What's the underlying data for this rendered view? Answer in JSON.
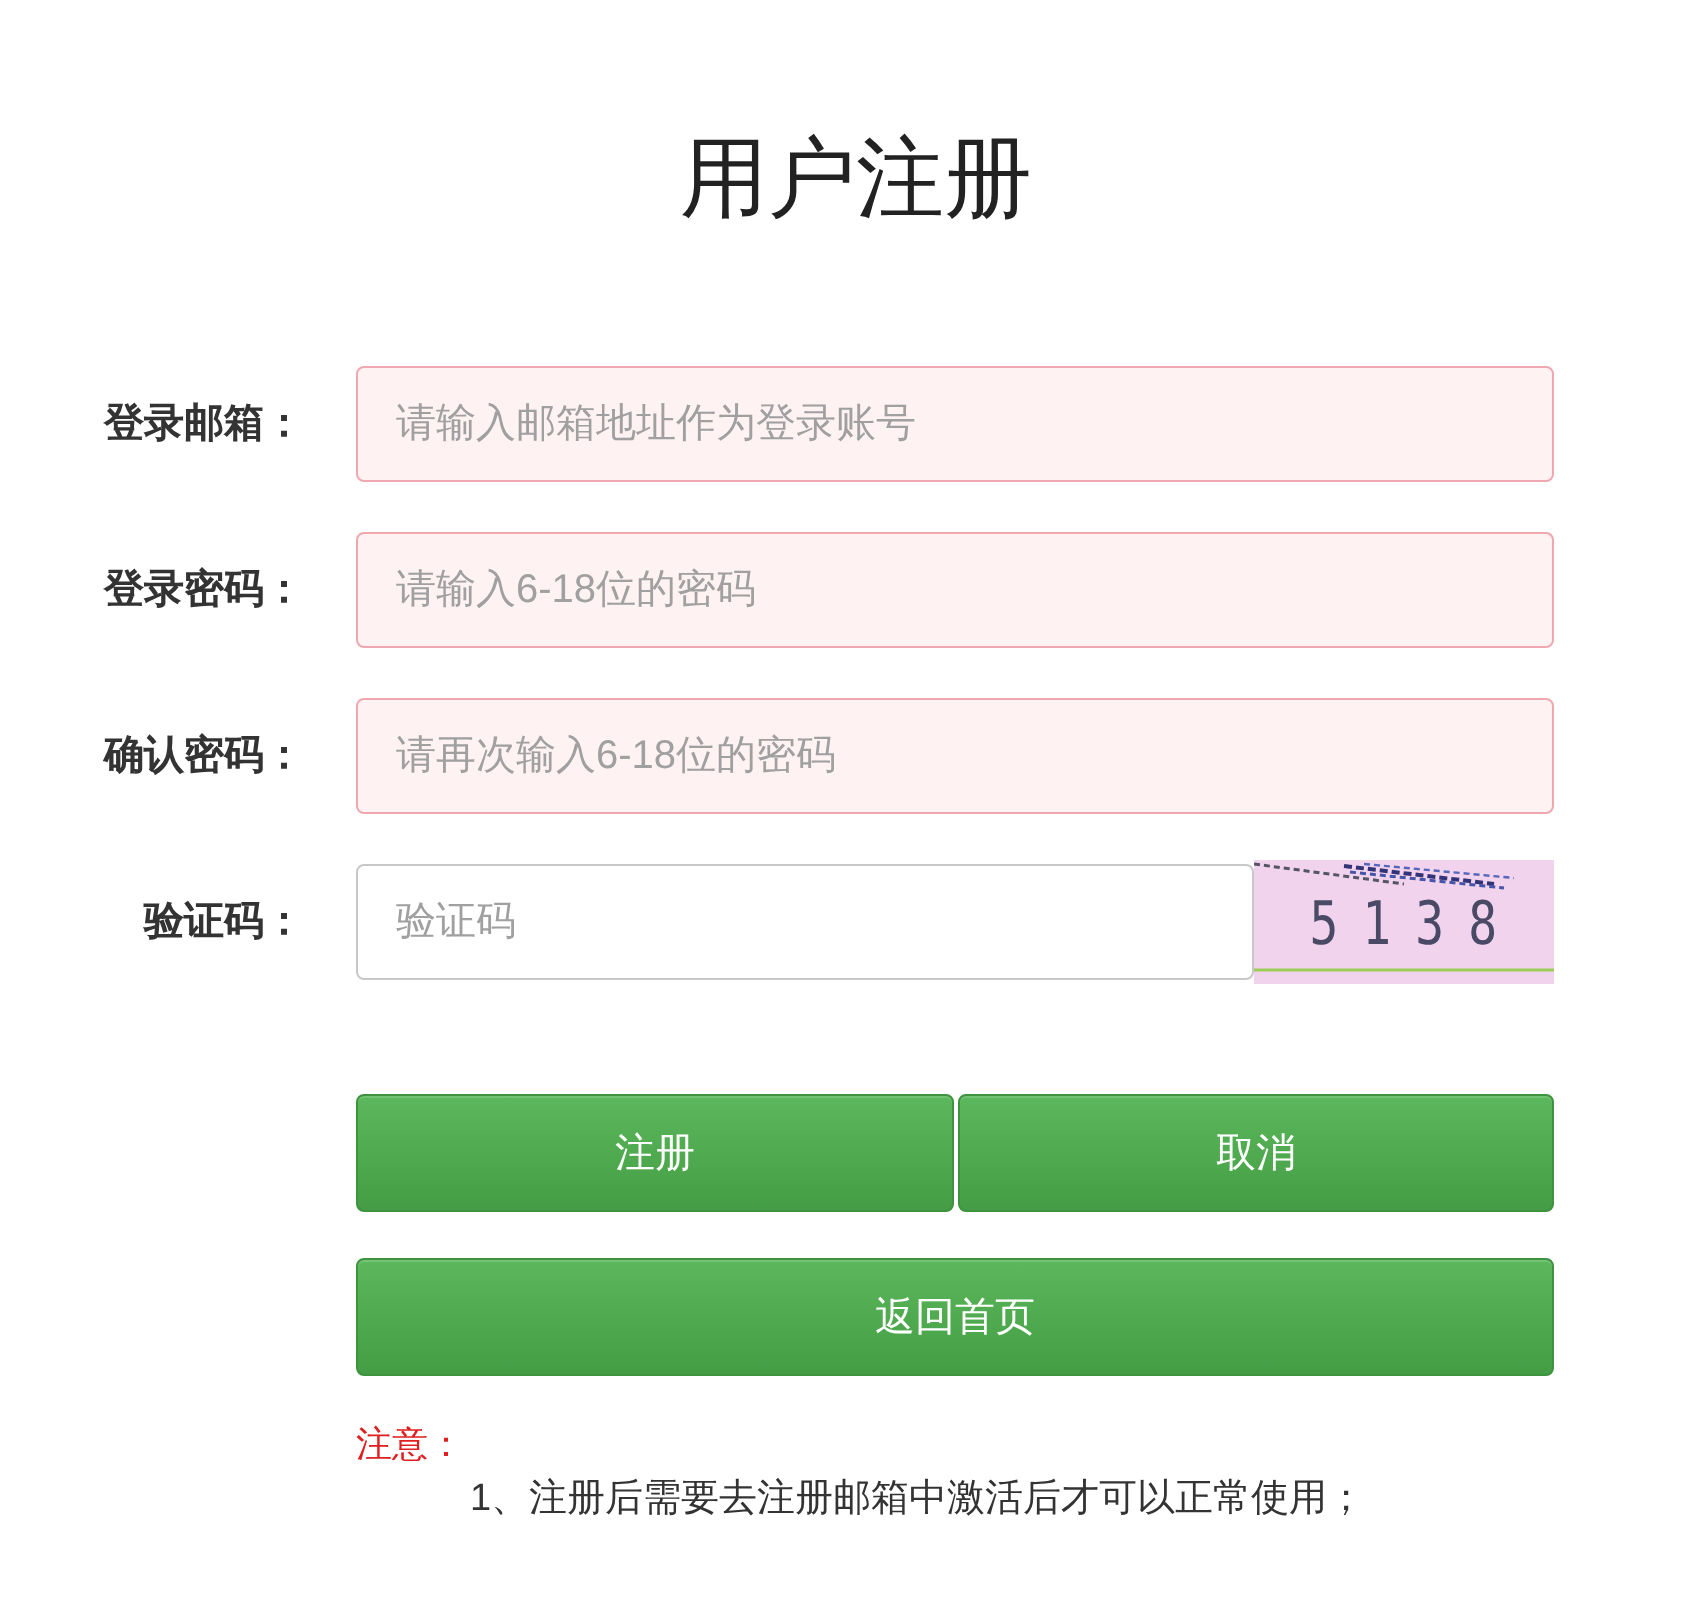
{
  "title": "用户注册",
  "fields": [
    {
      "kind": "text",
      "label": "登录邮箱：",
      "placeholder": "请输入邮箱地址作为登录账号",
      "error": true
    },
    {
      "kind": "text",
      "label": "登录密码：",
      "placeholder": "请输入6-18位的密码",
      "error": true
    },
    {
      "kind": "text",
      "label": "确认密码：",
      "placeholder": "请再次输入6-18位的密码",
      "error": true
    },
    {
      "kind": "captcha",
      "label": "验证码：",
      "placeholder": "验证码",
      "error": false,
      "captcha_code": "5138"
    }
  ],
  "button_rows": [
    [
      {
        "label": "注册"
      },
      {
        "label": "取消"
      }
    ],
    [
      {
        "label": "返回首页"
      }
    ]
  ],
  "notice": {
    "heading": "注意：",
    "items": [
      "1、注册后需要去注册邮箱中激活后才可以正常使用；"
    ]
  }
}
